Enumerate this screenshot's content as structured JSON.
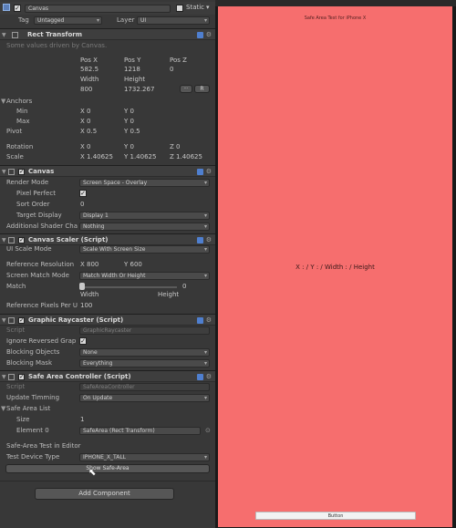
{
  "header": {
    "object_name": "Canvas",
    "static_label": "Static",
    "tag_label": "Tag",
    "tag_value": "Untagged",
    "layer_label": "Layer",
    "layer_value": "UI"
  },
  "rect_transform": {
    "title": "Rect Transform",
    "note": "Some values driven by Canvas.",
    "pos_x_label": "Pos X",
    "pos_y_label": "Pos Y",
    "pos_z_label": "Pos Z",
    "pos_x": "582.5",
    "pos_y": "1218",
    "pos_z": "0",
    "width_label": "Width",
    "height_label": "Height",
    "width": "800",
    "height": "1732.267",
    "r_button": "R",
    "anchors_label": "Anchors",
    "min_label": "Min",
    "max_label": "Max",
    "min_x": "X 0",
    "min_y": "Y 0",
    "max_x": "X 0",
    "max_y": "Y 0",
    "pivot_label": "Pivot",
    "pivot_x": "X 0.5",
    "pivot_y": "Y 0.5",
    "rotation_label": "Rotation",
    "rot_x": "X 0",
    "rot_y": "Y 0",
    "rot_z": "Z 0",
    "scale_label": "Scale",
    "scale_x": "X 1.40625",
    "scale_y": "Y 1.40625",
    "scale_z": "Z 1.40625"
  },
  "canvas": {
    "title": "Canvas",
    "render_mode_label": "Render Mode",
    "render_mode": "Screen Space - Overlay",
    "pixel_perfect_label": "Pixel Perfect",
    "sort_order_label": "Sort Order",
    "sort_order": "0",
    "target_display_label": "Target Display",
    "target_display": "Display 1",
    "shader_label": "Additional Shader Cha",
    "shader_value": "Nothing"
  },
  "canvas_scaler": {
    "title": "Canvas Scaler (Script)",
    "ui_scale_label": "UI Scale Mode",
    "ui_scale": "Scale With Screen Size",
    "ref_res_label": "Reference Resolution",
    "ref_x": "X  800",
    "ref_y": "Y  600",
    "match_mode_label": "Screen Match Mode",
    "match_mode": "Match Width Or Height",
    "match_label": "Match",
    "match_value": "0",
    "match_width": "Width",
    "match_height": "Height",
    "ref_ppu_label": "Reference Pixels Per U",
    "ref_ppu": "100"
  },
  "raycaster": {
    "title": "Graphic Raycaster (Script)",
    "script_label": "Script",
    "script_value": "GraphicRaycaster",
    "ignore_label": "Ignore Reversed Grap",
    "blocking_objects_label": "Blocking Objects",
    "blocking_objects": "None",
    "blocking_mask_label": "Blocking Mask",
    "blocking_mask": "Everything"
  },
  "safe_area": {
    "title": "Safe Area Controller (Script)",
    "script_label": "Script",
    "script_value": "SafeAreaController",
    "update_label": "Update Timming",
    "update_value": "On Update",
    "list_label": "Safe Area List",
    "size_label": "Size",
    "size_value": "1",
    "element_label": "Element 0",
    "element_value": "SafeArea (Rect Transform)",
    "test_header": "Safe-Area Test in Editor",
    "device_label": "Test Device Type",
    "device_value": "IPHONE_X_TALL",
    "show_button": "Show Safe-Area"
  },
  "add_component": "Add Component",
  "game_view": {
    "caption": "Safe Area Test for iPhone X",
    "center_text": "X : / Y : / Width : / Height",
    "button_label": "Button",
    "background": "#f66e6e"
  }
}
